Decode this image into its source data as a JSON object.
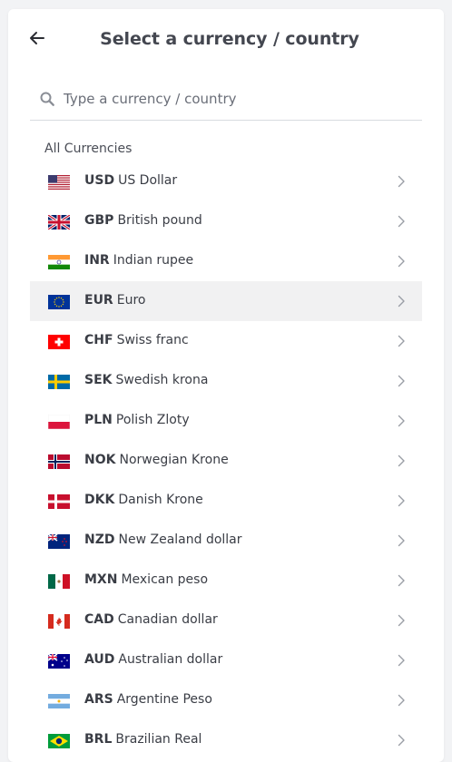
{
  "header": {
    "back_icon": "arrow-left-icon",
    "title": "Select a currency / country"
  },
  "search": {
    "icon": "search-icon",
    "placeholder": "Type a currency / country",
    "value": ""
  },
  "section_label": "All Currencies",
  "currencies": [
    {
      "code": "USD",
      "name": "US Dollar",
      "flag": "us-flag-icon",
      "selected": false
    },
    {
      "code": "GBP",
      "name": "British pound",
      "flag": "gb-flag-icon",
      "selected": false
    },
    {
      "code": "INR",
      "name": "Indian rupee",
      "flag": "in-flag-icon",
      "selected": false
    },
    {
      "code": "EUR",
      "name": "Euro",
      "flag": "eu-flag-icon",
      "selected": true
    },
    {
      "code": "CHF",
      "name": "Swiss franc",
      "flag": "ch-flag-icon",
      "selected": false
    },
    {
      "code": "SEK",
      "name": "Swedish krona",
      "flag": "se-flag-icon",
      "selected": false
    },
    {
      "code": "PLN",
      "name": "Polish Zloty",
      "flag": "pl-flag-icon",
      "selected": false
    },
    {
      "code": "NOK",
      "name": "Norwegian Krone",
      "flag": "no-flag-icon",
      "selected": false
    },
    {
      "code": "DKK",
      "name": "Danish Krone",
      "flag": "dk-flag-icon",
      "selected": false
    },
    {
      "code": "NZD",
      "name": "New Zealand dollar",
      "flag": "nz-flag-icon",
      "selected": false
    },
    {
      "code": "MXN",
      "name": "Mexican peso",
      "flag": "mx-flag-icon",
      "selected": false
    },
    {
      "code": "CAD",
      "name": "Canadian dollar",
      "flag": "ca-flag-icon",
      "selected": false
    },
    {
      "code": "AUD",
      "name": "Australian dollar",
      "flag": "au-flag-icon",
      "selected": false
    },
    {
      "code": "ARS",
      "name": "Argentine Peso",
      "flag": "ar-flag-icon",
      "selected": false
    },
    {
      "code": "BRL",
      "name": "Brazilian Real",
      "flag": "br-flag-icon",
      "selected": false
    }
  ],
  "colors": {
    "highlight_row": "#f1f1f2",
    "text": "#3a3d45",
    "chevron": "#9a9ea6"
  }
}
